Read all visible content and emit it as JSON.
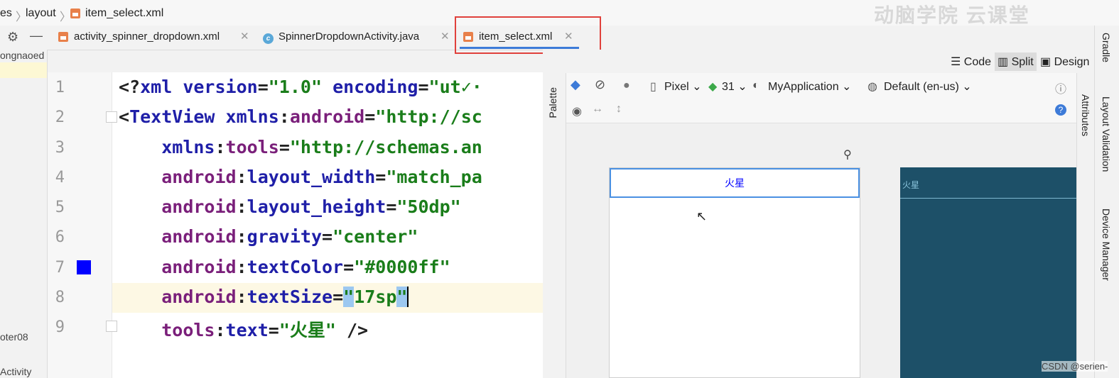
{
  "breadcrumb": {
    "items": [
      "es",
      "layout",
      "item_select.xml"
    ]
  },
  "watermark": "动脑学院  云课堂",
  "tabs": [
    {
      "label": "activity_spinner_dropdown.xml",
      "icon": "xml-file-icon",
      "active": false
    },
    {
      "label": "SpinnerDropdownActivity.java",
      "icon": "java-class-icon",
      "active": false
    },
    {
      "label": "item_select.xml",
      "icon": "xml-file-icon",
      "active": true
    }
  ],
  "project_panel": {
    "top_item": "ongnaoed",
    "item_chapter": "oter08",
    "item_activity": "Activity"
  },
  "view_modes": {
    "code": "Code",
    "split": "Split",
    "design": "Design",
    "selected": "Split"
  },
  "editor": {
    "line_numbers": [
      "1",
      "2",
      "3",
      "4",
      "5",
      "6",
      "7",
      "8",
      "9"
    ],
    "current_line": 8,
    "color_swatch": "#0000ff"
  },
  "design_toolbar": {
    "device": "Pixel",
    "api": "31",
    "theme": "MyApplication",
    "locale": "Default (en-us)"
  },
  "palette_label": "Palette",
  "attributes_label": "Attributes",
  "right_tools": {
    "gradle": "Gradle",
    "layout_validation": "Layout Validation",
    "device_manager": "Device Manager"
  },
  "preview": {
    "item_text": "火星",
    "text_color": "#0000ff",
    "blueprint_text": "火星"
  },
  "csdn_watermark": "CSDN @serien-"
}
